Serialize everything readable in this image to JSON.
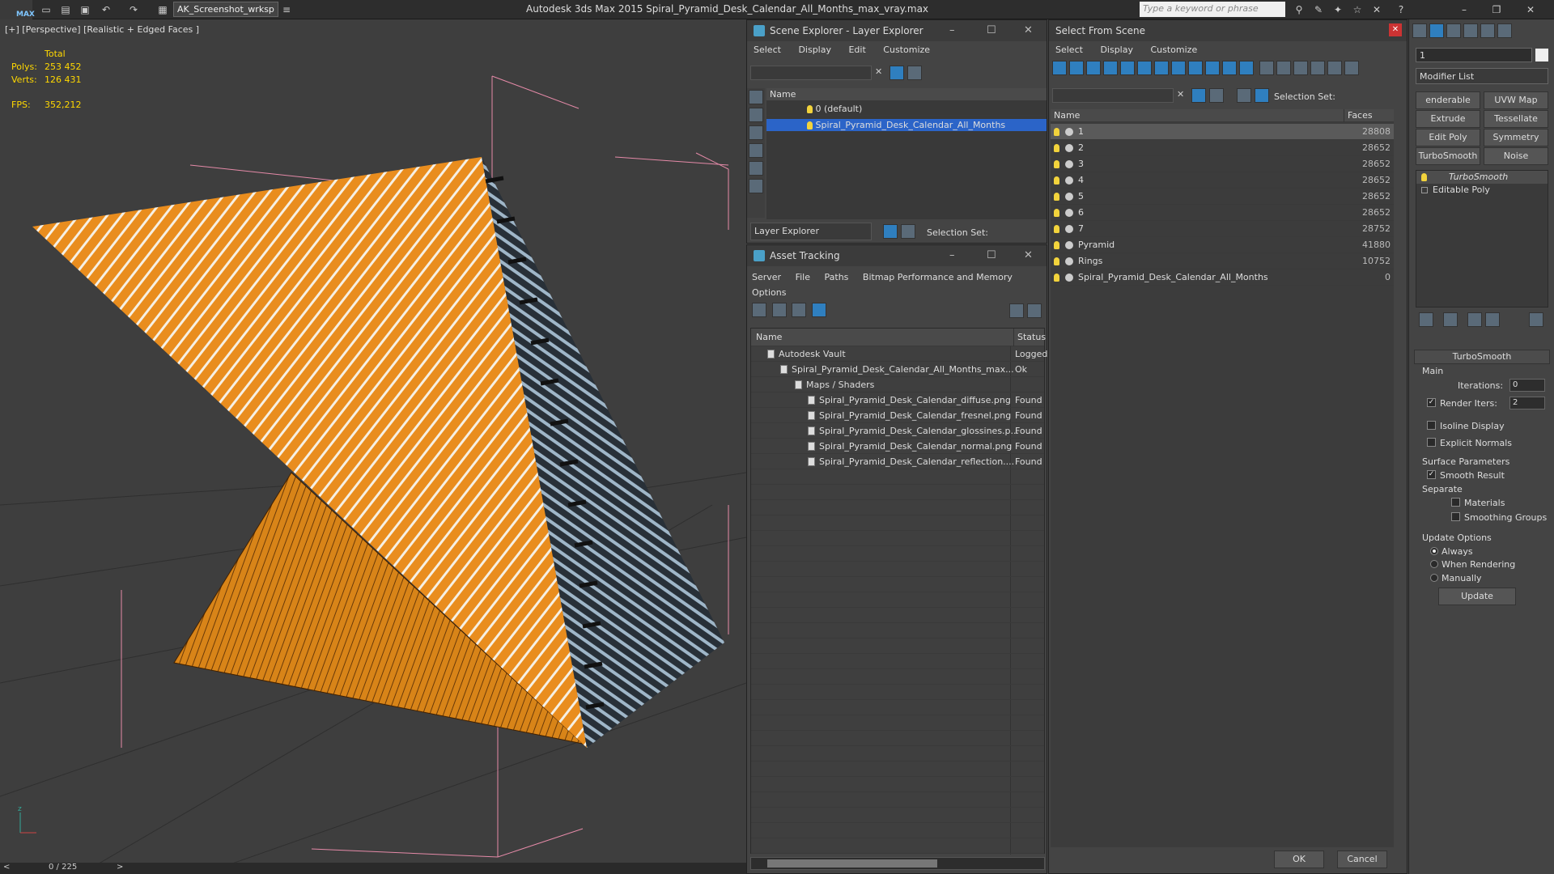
{
  "titlebar": {
    "logo": "MAX",
    "workspace": "AK_Screenshot_wrksp",
    "title": "Autodesk 3ds Max  2015    Spiral_Pyramid_Desk_Calendar_All_Months_max_vray.max",
    "search_placeholder": "Type a keyword or phrase"
  },
  "viewport": {
    "label": "[+] [Perspective] [Realistic + Edged Faces ]",
    "stats": {
      "total_label": "Total",
      "polys_label": "Polys:",
      "polys": "253 452",
      "verts_label": "Verts:",
      "verts": "126 431",
      "fps_label": "FPS:",
      "fps": "352,212"
    },
    "timeline": "0 / 225"
  },
  "scene_explorer": {
    "title": "Scene Explorer - Layer Explorer",
    "menu": [
      "Select",
      "Display",
      "Edit",
      "Customize"
    ],
    "column": "Name",
    "rows": [
      "0 (default)",
      "Spiral_Pyramid_Desk_Calendar_All_Months"
    ],
    "footer_dropdown": "Layer Explorer",
    "selection_set": "Selection Set:"
  },
  "asset_tracking": {
    "title": "Asset Tracking",
    "menu": [
      "Server",
      "File",
      "Paths",
      "Bitmap Performance and Memory",
      "Options"
    ],
    "columns": [
      "Name",
      "Status"
    ],
    "rows": [
      {
        "name": "Autodesk Vault",
        "status": "Logged"
      },
      {
        "name": "Spiral_Pyramid_Desk_Calendar_All_Months_max...",
        "status": "Ok"
      },
      {
        "name": "Maps / Shaders",
        "status": ""
      },
      {
        "name": "Spiral_Pyramid_Desk_Calendar_diffuse.png",
        "status": "Found"
      },
      {
        "name": "Spiral_Pyramid_Desk_Calendar_fresnel.png",
        "status": "Found"
      },
      {
        "name": "Spiral_Pyramid_Desk_Calendar_glossines.p...",
        "status": "Found"
      },
      {
        "name": "Spiral_Pyramid_Desk_Calendar_normal.png",
        "status": "Found"
      },
      {
        "name": "Spiral_Pyramid_Desk_Calendar_reflection....",
        "status": "Found"
      }
    ]
  },
  "select_from_scene": {
    "title": "Select From Scene",
    "menu": [
      "Select",
      "Display",
      "Customize"
    ],
    "selection_set": "Selection Set:",
    "columns": [
      "Name",
      "Faces"
    ],
    "rows": [
      {
        "name": "1",
        "faces": "28808"
      },
      {
        "name": "2",
        "faces": "28652"
      },
      {
        "name": "3",
        "faces": "28652"
      },
      {
        "name": "4",
        "faces": "28652"
      },
      {
        "name": "5",
        "faces": "28652"
      },
      {
        "name": "6",
        "faces": "28652"
      },
      {
        "name": "7",
        "faces": "28752"
      },
      {
        "name": "Pyramid",
        "faces": "41880"
      },
      {
        "name": "Rings",
        "faces": "10752"
      },
      {
        "name": "Spiral_Pyramid_Desk_Calendar_All_Months",
        "faces": "0"
      }
    ],
    "ok": "OK",
    "cancel": "Cancel"
  },
  "modify_panel": {
    "object_name": "1",
    "modifier_list": "Modifier List",
    "buttons": [
      "enderable Spli",
      "UVW Map",
      "Extrude",
      "Tessellate",
      "Edit Poly",
      "Symmetry",
      "TurboSmooth",
      "Noise"
    ],
    "stack": [
      "TurboSmooth",
      "Editable Poly"
    ],
    "rollout_title": "TurboSmooth",
    "main_label": "Main",
    "iterations_label": "Iterations:",
    "iterations": "0",
    "render_iters_label": "Render Iters:",
    "render_iters": "2",
    "isoline": "Isoline Display",
    "explicit": "Explicit Normals",
    "surface_label": "Surface Parameters",
    "smooth_result": "Smooth Result",
    "separate": "Separate",
    "materials": "Materials",
    "smoothing_groups": "Smoothing Groups",
    "update_options": "Update Options",
    "always": "Always",
    "when_rendering": "When Rendering",
    "manually": "Manually",
    "update": "Update"
  },
  "colors": {
    "selection": "#2b64c8",
    "pyramid_orange": "#e98d1e",
    "stats_yellow": "#ffd800"
  }
}
